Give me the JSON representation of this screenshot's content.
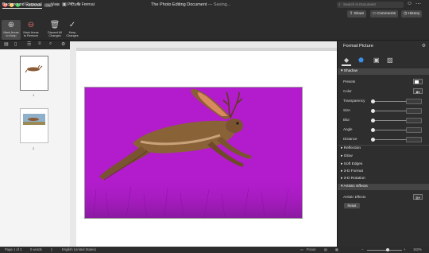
{
  "window": {
    "title": "The Photo Editing Document",
    "status": " — Saving...",
    "autosave_label": "AutoSave",
    "autosave_state": "ON",
    "search_placeholder": "Search in Document"
  },
  "tabs": [
    {
      "label": "Background Removal",
      "active": true
    },
    {
      "label": "View",
      "active": false
    },
    {
      "label": "Picture Format",
      "active": false
    }
  ],
  "header_buttons": {
    "share": "Share",
    "comments": "Comments",
    "history": "History"
  },
  "ribbon": {
    "mark_keep": [
      "Mark Areas",
      "to Keep"
    ],
    "mark_remove": [
      "Mark Areas",
      "to Remove"
    ],
    "discard": [
      "Discard All",
      "Changes"
    ],
    "keep": [
      "Keep",
      "Changes"
    ]
  },
  "pages": [
    {
      "number": "1"
    },
    {
      "number": "2"
    }
  ],
  "panel": {
    "title": "Format Picture",
    "tabs_icons": [
      "paint-bucket-icon",
      "pentagon-icon",
      "size-icon",
      "picture-icon"
    ],
    "shadow": {
      "header": "Shadow",
      "presets": "Presets",
      "color": "Color",
      "transparency": "Transparency",
      "size": "Size",
      "blur": "Blur",
      "angle": "Angle",
      "distance": "Distance"
    },
    "collapsed": [
      "Reflection",
      "Glow",
      "Soft Edges",
      "3-D Format",
      "3-D Rotation"
    ],
    "artistic": {
      "header": "Artistic Effects",
      "label": "Artistic Effects",
      "reset": "Reset"
    }
  },
  "status_bar": {
    "page": "Page 1 of 2",
    "words": "0 words",
    "language": "English (United States)",
    "focus": "Focus",
    "zoom": "162%"
  },
  "colors": {
    "photo_background": "#b21ccc",
    "accent": "#4a4a4a"
  }
}
